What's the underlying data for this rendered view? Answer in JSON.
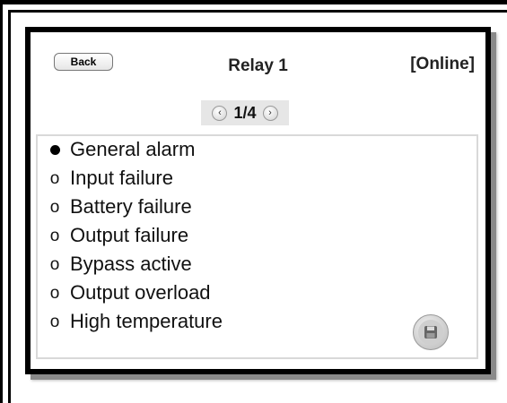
{
  "header": {
    "back_label": "Back",
    "title": "Relay 1",
    "status": "[Online]"
  },
  "pager": {
    "text": "1/4",
    "prev_icon": "chevron-left-icon",
    "next_icon": "chevron-right-icon"
  },
  "options": {
    "items": [
      {
        "label": "General alarm",
        "selected": true
      },
      {
        "label": "Input failure",
        "selected": false
      },
      {
        "label": "Battery failure",
        "selected": false
      },
      {
        "label": "Output failure",
        "selected": false
      },
      {
        "label": "Bypass active",
        "selected": false
      },
      {
        "label": "Output overload",
        "selected": false
      },
      {
        "label": "High temperature",
        "selected": false
      }
    ],
    "unselected_marker": "o"
  },
  "save": {
    "icon": "floppy-disk-icon"
  }
}
